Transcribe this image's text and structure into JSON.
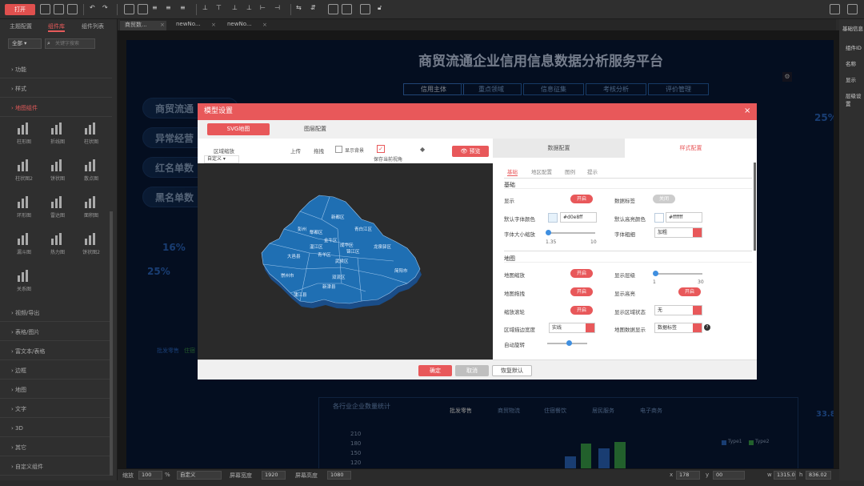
{
  "toolbar": {
    "open_label": "打开"
  },
  "left": {
    "tabs": [
      "主题配置",
      "组件库",
      "组件列表"
    ],
    "filter_select": "全部",
    "search_placeholder": "关键字搜索",
    "categories_top": [
      "功能",
      "样式",
      "地图组件"
    ],
    "charts": [
      {
        "label": "柱形图"
      },
      {
        "label": "折线图"
      },
      {
        "label": "柱状图"
      },
      {
        "label": "柱状图2"
      },
      {
        "label": "饼状图"
      },
      {
        "label": "散点图"
      },
      {
        "label": "环形图"
      },
      {
        "label": "雷达图"
      },
      {
        "label": "面积图"
      },
      {
        "label": "漏斗图"
      },
      {
        "label": "热力图"
      },
      {
        "label": "饼状图2"
      },
      {
        "label": "关系图"
      }
    ],
    "categories_bottom": [
      "视频/导出",
      "表格/图片",
      "富文本/表格",
      "边框",
      "地图",
      "文字",
      "3D",
      "其它",
      "自定义组件"
    ]
  },
  "doc_tabs": [
    "商贸数...",
    "newNo...",
    "newNo..."
  ],
  "platform": {
    "title": "商贸流通企业信用信息数据分析服务平台",
    "nav": [
      "信用主体",
      "重点领域",
      "信息征集",
      "考核分析",
      "评价管理"
    ],
    "left_cards": [
      "商贸流通",
      "异常经营",
      "红名单数",
      "黑名单数"
    ],
    "stats": [
      "16%",
      "25%"
    ],
    "right_stat": "25%",
    "legend_labels": [
      "批发零售",
      "住宿"
    ],
    "bottom_title": "各行业企业数量统计",
    "bottom_tabs": [
      "批发零售",
      "商贸物流",
      "住宿餐饮",
      "居民服务",
      "电子商务"
    ],
    "y_ticks": [
      "210",
      "180",
      "150",
      "120"
    ],
    "legend": [
      "Type1",
      "Type2"
    ],
    "right_num": "33.8"
  },
  "dialog": {
    "title": "模型设置",
    "tabs": [
      "SVG地图",
      "图层配置"
    ],
    "map_tools": {
      "zoom_label": "区域缩放",
      "upload": "上传",
      "drag": "拖拽",
      "bg_label": "显示背景",
      "keep_label": "保存当前视角",
      "custom": "自定义",
      "view_btn": "预览"
    },
    "districts": [
      "新都区",
      "青白江区",
      "郫都区",
      "彭州",
      "温江区",
      "成华区",
      "金牛区",
      "武侯区",
      "锦江区",
      "青羊区",
      "龙泉驿区",
      "双流区",
      "大邑县",
      "崇州市",
      "新津县",
      "简阳市",
      "蒲江县"
    ],
    "right_tabs": [
      "数据配置",
      "样式配置"
    ],
    "sub_tabs": [
      "基础",
      "地区配置",
      "图例",
      "提示"
    ],
    "section_base": "基础",
    "rows_a": [
      {
        "l": "显示",
        "t": "开启"
      },
      {
        "l": "默认字体颜色",
        "c": "#d0e8ff"
      },
      {
        "l": "字体大小缩放"
      }
    ],
    "rows_b": [
      {
        "l": "数据标签",
        "t": "关闭"
      },
      {
        "l": "默认高亮颜色",
        "c": "#ffffff"
      },
      {
        "l": "字体粗细",
        "s": "加粗"
      }
    ],
    "section_map": "地图",
    "rows_c": [
      {
        "l": "地图缩放",
        "t": "开启"
      },
      {
        "l": "地图拖拽",
        "t": "开启"
      },
      {
        "l": "缩放滚轮",
        "t": "开启"
      },
      {
        "l": "区域描边宽度",
        "s": "实线"
      },
      {
        "l": "自动旋转"
      }
    ],
    "rows_d": [
      {
        "l": "显示层级"
      },
      {
        "l": "显示高亮",
        "t": "开启"
      },
      {
        "l": "显示区域状态",
        "s": "无"
      },
      {
        "l": "地图数据显示",
        "s": "数据标签"
      }
    ],
    "slider_min": "1.35",
    "slider_max": "10",
    "depth_min": "1",
    "depth_max": "30",
    "ok": "确定",
    "cancel": "取消",
    "reset": "恢复默认"
  },
  "status": {
    "zoom_label": "缩放",
    "zoom": "100",
    "pct": "%",
    "mode": "自定义",
    "w_label": "屏幕宽度",
    "w": "1920",
    "h_label": "屏幕高度",
    "h": "1080",
    "x_label": "x",
    "x": "178",
    "y_label": "y",
    "y": "00",
    "W_label": "w",
    "W": "1315.0",
    "H_label": "h",
    "H": "836.02"
  },
  "right": {
    "items": [
      "基础信息",
      "组件ID",
      "名称",
      "显示",
      "层级设置"
    ]
  }
}
